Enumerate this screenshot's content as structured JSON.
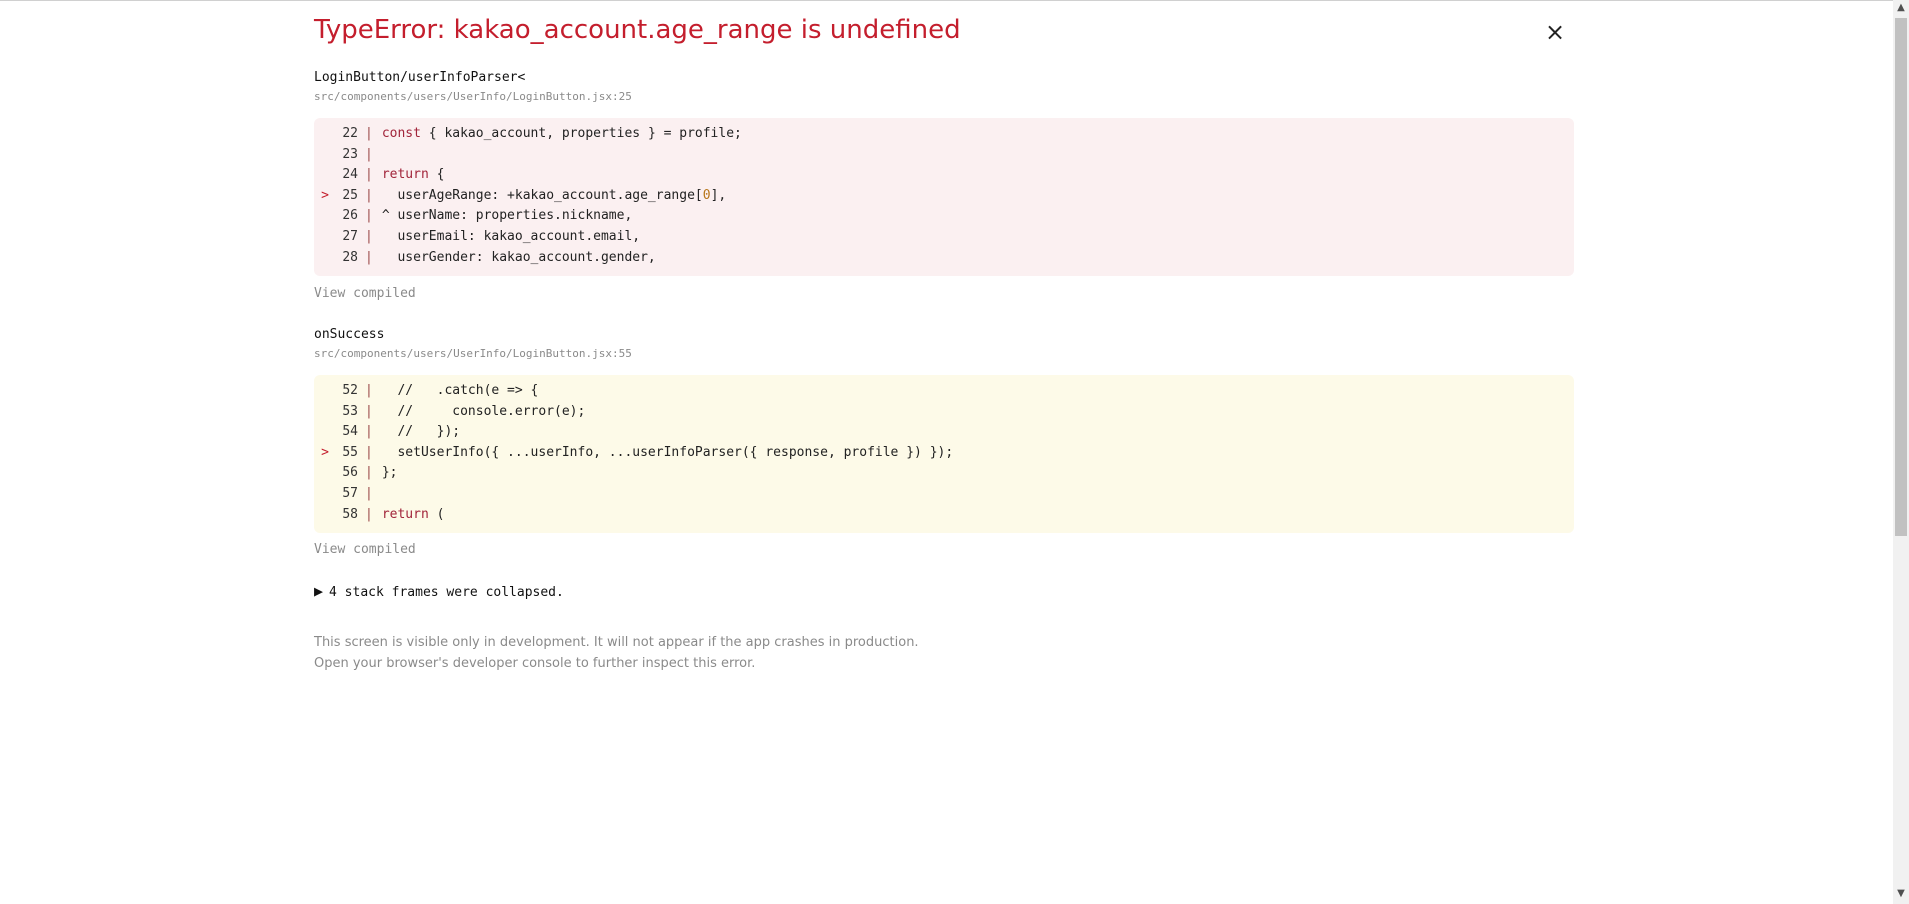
{
  "error": {
    "title": "TypeError: kakao_account.age_range is undefined",
    "close_label": "×"
  },
  "frames": [
    {
      "function": "LoginButton/userInfoParser<",
      "file": "src/components/users/UserInfo/LoginButton.jsx:25",
      "view_compiled": "View compiled",
      "lines": [
        {
          "marker": "",
          "num": "22",
          "code": "const { kakao_account, properties } = profile;"
        },
        {
          "marker": "",
          "num": "23",
          "code": ""
        },
        {
          "marker": "",
          "num": "24",
          "code": "return {"
        },
        {
          "marker": ">",
          "num": "25",
          "code": "  userAgeRange: +kakao_account.age_range[0],"
        },
        {
          "marker": "",
          "num": "26",
          "code": "^ userName: properties.nickname,"
        },
        {
          "marker": "",
          "num": "27",
          "code": "  userEmail: kakao_account.email,"
        },
        {
          "marker": "",
          "num": "28",
          "code": "  userGender: kakao_account.gender,"
        }
      ]
    },
    {
      "function": "onSuccess",
      "file": "src/components/users/UserInfo/LoginButton.jsx:55",
      "view_compiled": "View compiled",
      "lines": [
        {
          "marker": "",
          "num": "52",
          "code": "  //   .catch(e => {"
        },
        {
          "marker": "",
          "num": "53",
          "code": "  //     console.error(e);"
        },
        {
          "marker": "",
          "num": "54",
          "code": "  //   });"
        },
        {
          "marker": ">",
          "num": "55",
          "code": "  setUserInfo({ ...userInfo, ...userInfoParser({ response, profile }) });"
        },
        {
          "marker": "",
          "num": "56",
          "code": "};"
        },
        {
          "marker": "",
          "num": "57",
          "code": ""
        },
        {
          "marker": "",
          "num": "58",
          "code": "return ("
        }
      ]
    }
  ],
  "collapsed": {
    "icon": "▶",
    "label": "4 stack frames were collapsed."
  },
  "footer": {
    "line1": "This screen is visible only in development. It will not appear if the app crashes in production.",
    "line2": "Open your browser's developer console to further inspect this error."
  },
  "scrollbar": {
    "up_arrow": "▲",
    "down_arrow": "▼"
  },
  "colors": {
    "error_red": "#c41e2d",
    "frame1_bg": "#fbf0f1",
    "frame2_bg": "#fdfae8"
  }
}
